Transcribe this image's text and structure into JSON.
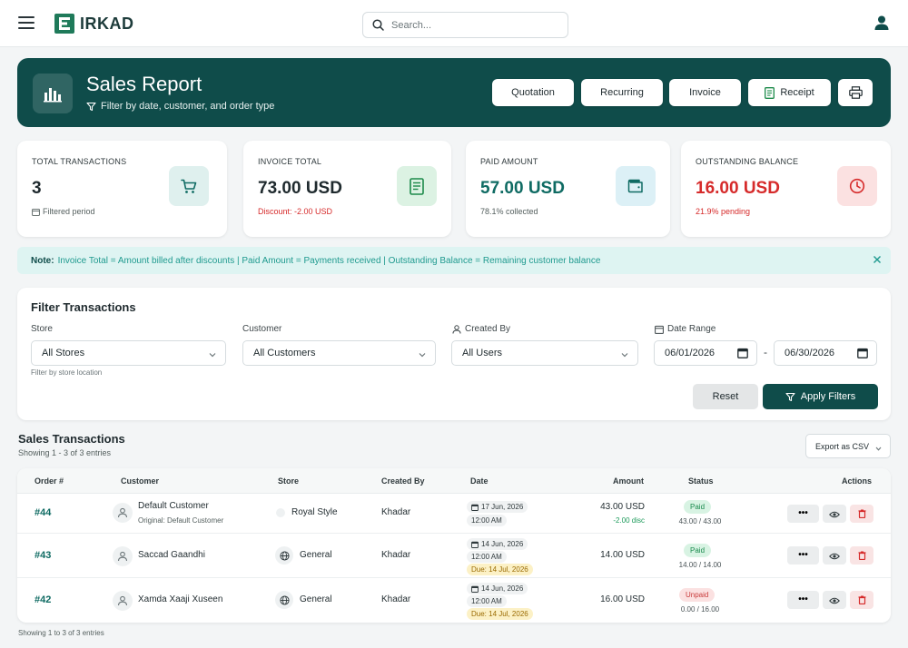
{
  "app": {
    "brand": "IRKAD"
  },
  "search": {
    "placeholder": "Search..."
  },
  "hero": {
    "title": "Sales Report",
    "subtitle": "Filter by date, customer, and order type",
    "buttons": [
      "Quotation",
      "Recurring",
      "Invoice",
      "Receipt"
    ]
  },
  "stats": [
    {
      "label": "TOTAL TRANSACTIONS",
      "value": "3",
      "sub": "Filtered period"
    },
    {
      "label": "INVOICE TOTAL",
      "value": "73.00 USD",
      "sub": "Discount: -2.00 USD"
    },
    {
      "label": "PAID AMOUNT",
      "value": "57.00 USD",
      "sub": "78.1% collected"
    },
    {
      "label": "OUTSTANDING BALANCE",
      "value": "16.00 USD",
      "sub": "21.9% pending"
    }
  ],
  "note": {
    "label": "Note:",
    "text": "Invoice Total = Amount billed after discounts | Paid Amount = Payments received | Outstanding Balance = Remaining customer balance"
  },
  "filters": {
    "title": "Filter Transactions",
    "store_label": "Store",
    "store_value": "All Stores",
    "store_hint": "Filter by store location",
    "customer_label": "Customer",
    "customer_value": "All Customers",
    "created_by_label": "Created By",
    "created_by_value": "All Users",
    "date_range_label": "Date Range",
    "date_from": "06/01/2026",
    "date_to": "06/30/2026",
    "separator": "-",
    "reset_label": "Reset",
    "apply_label": "Apply Filters"
  },
  "transactions": {
    "title": "Sales Transactions",
    "count_text": "Showing 1 - 3 of 3 entries",
    "export_label": "Export as CSV",
    "columns": [
      "Order #",
      "Customer",
      "Store",
      "Created By",
      "Date",
      "Amount",
      "Status",
      "Actions"
    ],
    "rows": [
      {
        "order": "#44",
        "customer": "Default Customer",
        "customer_sub": "Original: Default Customer",
        "store": "Royal Style",
        "created_by": "Khadar",
        "date": "17 Jun, 2026",
        "time": "12:00 AM",
        "due": "",
        "amount": "43.00 USD",
        "discount": "-2.00 disc",
        "status": "Paid",
        "paid_ratio": "43.00 / 43.00"
      },
      {
        "order": "#43",
        "customer": "Saccad Gaandhi",
        "customer_sub": "",
        "store": "General",
        "created_by": "Khadar",
        "date": "14 Jun, 2026",
        "time": "12:00 AM",
        "due": "Due: 14 Jul, 2026",
        "amount": "14.00 USD",
        "discount": "",
        "status": "Paid",
        "paid_ratio": "14.00 / 14.00"
      },
      {
        "order": "#42",
        "customer": "Xamda Xaaji Xuseen",
        "customer_sub": "",
        "store": "General",
        "created_by": "Khadar",
        "date": "14 Jun, 2026",
        "time": "12:00 AM",
        "due": "Due: 14 Jul, 2026",
        "amount": "16.00 USD",
        "discount": "",
        "status": "Unpaid",
        "paid_ratio": "0.00 / 16.00"
      }
    ],
    "footer_text": "Showing 1 to 3 of 3 entries"
  },
  "colors": {
    "primary": "#0f4c4a",
    "paid": "#1a8a4e",
    "unpaid": "#c83a3a",
    "outstanding": "#d62b2b",
    "paid_amount": "#0f6b63"
  },
  "icons": [
    "menu-icon",
    "search-icon",
    "user-icon",
    "bar-chart-icon",
    "filter-icon",
    "receipt-icon",
    "print-icon",
    "cart-icon",
    "document-icon",
    "wallet-icon",
    "clock-icon",
    "calendar-icon",
    "close-icon",
    "chevron-down-icon",
    "globe-icon",
    "more-icon",
    "eye-icon",
    "trash-icon"
  ]
}
